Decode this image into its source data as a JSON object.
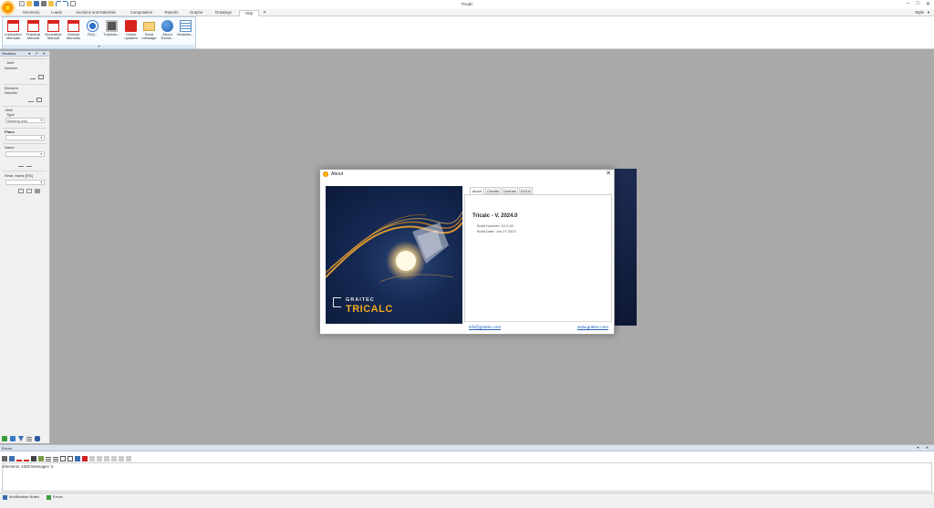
{
  "window": {
    "title": "Tricalc",
    "controls": [
      "–",
      "□",
      "✕"
    ]
  },
  "ribbon": {
    "tabs": [
      {
        "label": "Geometry"
      },
      {
        "label": "Loads"
      },
      {
        "label": "Sections and Materials"
      },
      {
        "label": "Computation"
      },
      {
        "label": "Reports"
      },
      {
        "label": "Graphs"
      },
      {
        "label": "Drawings"
      },
      {
        "label": "Help"
      },
      {
        "label": "✕"
      }
    ],
    "style_label": "Style",
    "style_chevron": "▼",
    "group_footer": "▾",
    "buttons": [
      {
        "line1": "Instruction",
        "line2": "Manuals",
        "icon": "pdf-icon"
      },
      {
        "line1": "Practical",
        "line2": "Manual",
        "icon": "pdf-icon"
      },
      {
        "line1": "Normative",
        "line2": "Manual",
        "icon": "pdf-icon"
      },
      {
        "line1": "Default",
        "line2": "Manuals",
        "icon": "pdf-icon"
      },
      {
        "line1": "FAQ...",
        "line2": "",
        "icon": "faq-icon"
      },
      {
        "line1": "Tutorials...",
        "line2": "",
        "icon": "tutorials-icon"
      },
      {
        "line1": "Online",
        "line2": "updates",
        "icon": "online-updates-icon"
      },
      {
        "line1": "Send",
        "line2": "message",
        "icon": "envelope-icon"
      },
      {
        "line1": "About",
        "line2": "Tricalc...",
        "icon": "info-icon"
      },
      {
        "line1": "Modules...",
        "line2": "",
        "icon": "modules-icon"
      }
    ]
  },
  "left_panel": {
    "title": "Sections",
    "controls": "▾ ↗ ✕",
    "joint_label": "Joint",
    "joint_sub": "Number",
    "element_label": "Element",
    "element_sub": "Number",
    "wall_label": "Wall",
    "wall_type_label": "Type",
    "wall_type_value": "Bearing wall",
    "plans_label": "Plans",
    "name_label": "Name",
    "restr_label": "Restr. frame [EN]",
    "chevron": "▼"
  },
  "about_dialog": {
    "title": "About",
    "close": "✕",
    "company": "GRAITEC",
    "product": "TRICALC",
    "tabs": [
      {
        "label": "About"
      },
      {
        "label": "Credits"
      },
      {
        "label": "License"
      },
      {
        "label": "EULA"
      }
    ],
    "product_version": "Tricalc - V. 2024.0",
    "build_number": "Build Number: 10.0.00",
    "build_date": "Build Date: Jun 27 2023",
    "email": "info@graitec.com",
    "website": "www.graitec.com"
  },
  "bottom_pane": {
    "title": "Errors",
    "controls": "▾ ✕",
    "message": "Elements: 4300 Messages: 0"
  },
  "status_tabs": [
    {
      "label": "Modification Notes"
    },
    {
      "label": "Errors"
    }
  ],
  "colors": {
    "accent_orange": "#f39200",
    "pdf_red": "#d9231d",
    "link_blue": "#1f5fbf",
    "workspace_gray": "#a9a9a9"
  }
}
